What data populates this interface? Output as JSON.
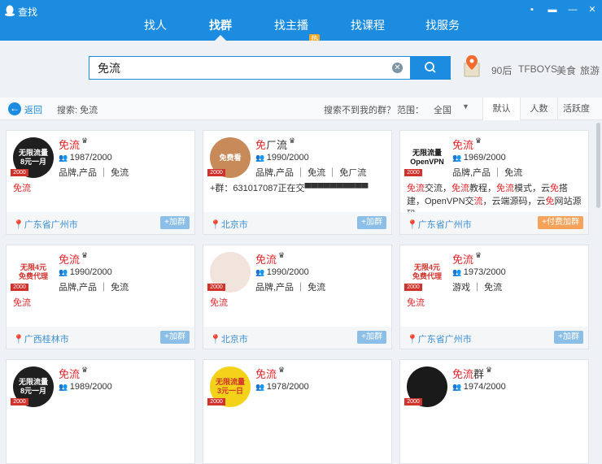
{
  "window": {
    "title": "查找",
    "controls": [
      "▪",
      "▬",
      "—",
      "✕"
    ]
  },
  "nav": [
    {
      "label": "找人",
      "active": false
    },
    {
      "label": "找群",
      "active": true
    },
    {
      "label": "找主播",
      "active": false,
      "badge": "热"
    },
    {
      "label": "找课程",
      "active": false
    },
    {
      "label": "找服务",
      "active": false
    }
  ],
  "search": {
    "value": "免流",
    "placeholder": ""
  },
  "hot_keywords": [
    "90后",
    "TFBOYS",
    "美食",
    "旅游"
  ],
  "filter": {
    "back_label": "返回",
    "query_prefix": "搜索: 免流",
    "not_found_text": "搜索不到我的群？",
    "range_label": "范围：",
    "range_value": "全国",
    "sort_tabs": [
      "默认",
      "人数",
      "活跃度"
    ]
  },
  "cards": [
    {
      "name_hl": "免流",
      "name_rest": "",
      "count": "1987/2000",
      "tags": "品牌,产品 ｜ 免流",
      "desc": [
        {
          "t": "免流",
          "h": true
        }
      ],
      "location": "广东省广州市",
      "join": "+加群",
      "avatar_text": "无限流量\n8元一月",
      "avatar_bg": "#1f1f1f",
      "avatar_fg": "#fff"
    },
    {
      "name_hl": "免",
      "name_rest": "ㄏ流",
      "count": "1990/2000",
      "tags": "品牌,产品 ｜ 免流 ｜ 免ㄏ流",
      "desc": [
        {
          "t": "+群：631017087正在交▀▀▀▀▀▀▀▀▀▀",
          "h": false
        }
      ],
      "location": "北京市",
      "join": "+加群",
      "avatar_text": "免费看",
      "avatar_bg": "#c98a5a",
      "avatar_fg": "#fff"
    },
    {
      "name_hl": "免流",
      "name_rest": "",
      "count": "1969/2000",
      "tags": "品牌,产品 ｜ 免流",
      "desc": [
        {
          "t": "免流",
          "h": true
        },
        {
          "t": "交流，",
          "h": false
        },
        {
          "t": "免流",
          "h": true
        },
        {
          "t": "教程，",
          "h": false
        },
        {
          "t": "免流",
          "h": true
        },
        {
          "t": "模式，云",
          "h": false
        },
        {
          "t": "免",
          "h": true
        },
        {
          "t": "搭建，OpenVPN交",
          "h": false
        },
        {
          "t": "流",
          "h": true
        },
        {
          "t": "，云端源码，云",
          "h": false
        },
        {
          "t": "免",
          "h": true
        },
        {
          "t": "网站源码。",
          "h": false
        }
      ],
      "location": "广东省广州市",
      "join": "+付费加群",
      "paid": true,
      "avatar_text": "无限流量\nOpenVPN",
      "avatar_bg": "#ffffff",
      "avatar_fg": "#111"
    },
    {
      "name_hl": "免流",
      "name_rest": "",
      "count": "1990/2000",
      "tags": "品牌,产品 ｜ 免流",
      "desc": [
        {
          "t": "免流",
          "h": true
        }
      ],
      "location": "广西桂林市",
      "join": "+加群",
      "avatar_text": "无限4元\n免费代理",
      "avatar_bg": "#ffffff",
      "avatar_fg": "#d1322b"
    },
    {
      "name_hl": "免流",
      "name_rest": "",
      "count": "1990/2000",
      "tags": "品牌,产品 ｜ 免流",
      "desc": [
        {
          "t": "免流",
          "h": true
        }
      ],
      "location": "北京市",
      "join": "+加群",
      "avatar_text": "",
      "avatar_bg": "#f1e4dc",
      "avatar_fg": "#333"
    },
    {
      "name_hl": "免流",
      "name_rest": "",
      "count": "1973/2000",
      "tags": "游戏 ｜ 免流",
      "desc": [
        {
          "t": "免流",
          "h": true
        }
      ],
      "location": "广东省广州市",
      "join": "+加群",
      "avatar_text": "无限4元\n免费代理",
      "avatar_bg": "#ffffff",
      "avatar_fg": "#d1322b"
    },
    {
      "name_hl": "免流",
      "name_rest": "",
      "count": "1989/2000",
      "tags": "",
      "desc": [],
      "location": "",
      "join": "",
      "avatar_text": "无限流量\n8元一月",
      "avatar_bg": "#1f1f1f",
      "avatar_fg": "#fff"
    },
    {
      "name_hl": "免流",
      "name_rest": "",
      "count": "1978/2000",
      "tags": "",
      "desc": [],
      "location": "",
      "join": "",
      "avatar_text": "无限流量\n3元一日",
      "avatar_bg": "#f4d21a",
      "avatar_fg": "#d1322b"
    },
    {
      "name_hl": "免流",
      "name_rest": "群",
      "count": "1974/2000",
      "tags": "",
      "desc": [],
      "location": "",
      "join": "",
      "avatar_text": "",
      "avatar_bg": "#1a1a1a",
      "avatar_fg": "#e0b43a"
    }
  ],
  "level_label": "2000"
}
